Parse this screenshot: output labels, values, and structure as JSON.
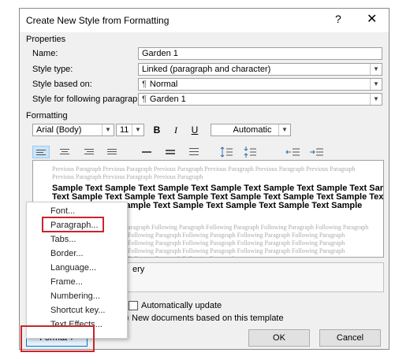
{
  "dialog": {
    "title": "Create New Style from Formatting",
    "help_glyph": "?",
    "close_glyph": "✕"
  },
  "properties": {
    "heading": "Properties",
    "name_label": "Name:",
    "name_value": "Garden 1",
    "type_label": "Style type:",
    "type_value": "Linked (paragraph and character)",
    "based_label": "Style based on:",
    "based_value": "Normal",
    "following_label": "Style for following paragraph:",
    "following_value": "Garden 1",
    "para_mark": "¶"
  },
  "formatting": {
    "heading": "Formatting",
    "font": "Arial (Body)",
    "size": "11",
    "bold": "B",
    "italic": "I",
    "underline": "U",
    "color": "Automatic"
  },
  "preview": {
    "previous": "Previous Paragraph Previous Paragraph Previous Paragraph Previous Paragraph Previous Paragraph Previous Paragraph Previous Paragraph Previous Paragraph Previous Paragraph",
    "sample_line1": "Sample Text Sample Text Sample Text Sample Text Sample Text Sample Text Sample",
    "sample_line2": "Text Sample Text Sample Text Sample Text Sample Text Sample Text Sample Text",
    "sample_line3": "ext Sample Text Sample Text Sample Text Sample Text Sample Text Sample",
    "following": "aragraph Following Paragraph Following Paragraph Following Paragraph Following Paragraph Following Paragraph Following Paragraph Following Paragraph Following Paragraph Following Paragraph Following Paragraph Following Paragraph Following Paragraph Following Paragraph Following Paragraph Following Paragraph Following Paragraph Following Paragraph Following Paragraph"
  },
  "description": {
    "line1": "ery"
  },
  "options": {
    "auto_update": "Automatically update",
    "new_docs": "New documents based on this template"
  },
  "menu": {
    "items": [
      "Font...",
      "Paragraph...",
      "Tabs...",
      "Border...",
      "Language...",
      "Frame...",
      "Numbering...",
      "Shortcut key...",
      "Text Effects..."
    ]
  },
  "buttons": {
    "format": "Format ▾",
    "ok": "OK",
    "cancel": "Cancel"
  },
  "colors": {
    "highlight": "#c8262d",
    "accent_selected": "#cce4f7"
  }
}
